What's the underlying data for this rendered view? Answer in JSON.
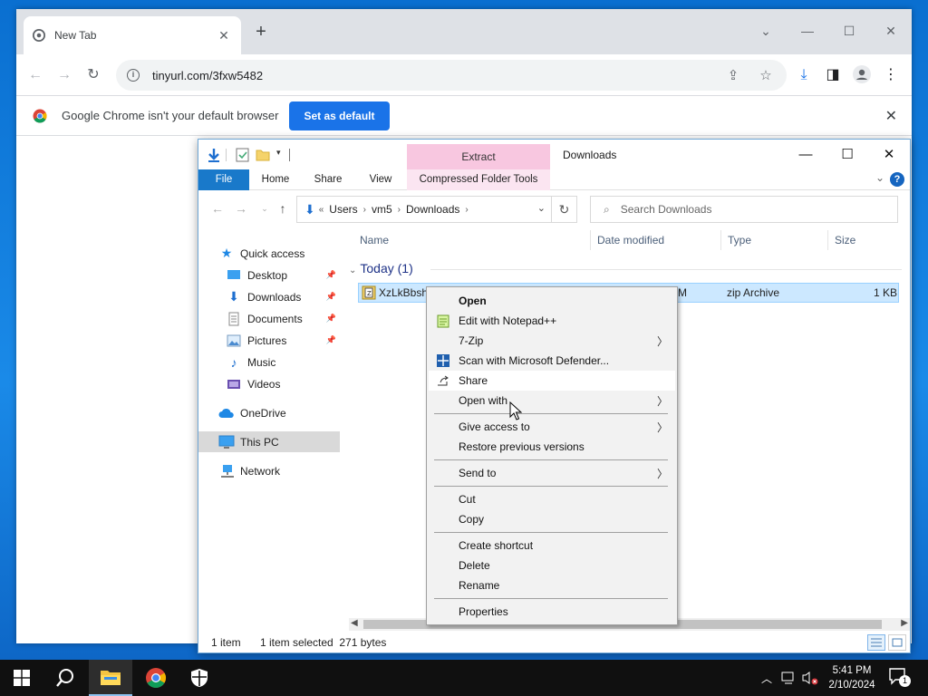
{
  "chrome": {
    "tab_title": "New Tab",
    "url": "tinyurl.com/3fxw5482",
    "infobar_message": "Google Chrome isn't your default browser",
    "infobar_button": "Set as default"
  },
  "explorer": {
    "contextual_tab": "Extract",
    "window_title": "Downloads",
    "ribbon_tabs": [
      "File",
      "Home",
      "Share",
      "View",
      "Compressed Folder Tools"
    ],
    "breadcrumb": [
      "Users",
      "vm5",
      "Downloads"
    ],
    "breadcrumb_prefix": "«",
    "search_placeholder": "Search Downloads",
    "nav_items": [
      {
        "label": "Quick access"
      },
      {
        "label": "Desktop"
      },
      {
        "label": "Downloads"
      },
      {
        "label": "Documents"
      },
      {
        "label": "Pictures"
      },
      {
        "label": "Music"
      },
      {
        "label": "Videos"
      },
      {
        "label": "OneDrive"
      },
      {
        "label": "This PC"
      },
      {
        "label": "Network"
      }
    ],
    "columns": [
      "Name",
      "Date modified",
      "Type",
      "Size"
    ],
    "group_label": "Today (1)",
    "file": {
      "name": "XzLkBbshc",
      "date_fragment": "M",
      "type": "zip Archive",
      "size": "1 KB"
    },
    "status": {
      "items": "1 item",
      "selected": "1 item selected  271 bytes"
    }
  },
  "context_menu": {
    "items": [
      {
        "label": "Open"
      },
      {
        "label": "Edit with Notepad++"
      },
      {
        "label": "7-Zip"
      },
      {
        "label": "Scan with Microsoft Defender..."
      },
      {
        "label": "Share"
      },
      {
        "label": "Open with"
      },
      {
        "label": "Give access to"
      },
      {
        "label": "Restore previous versions"
      },
      {
        "label": "Send to"
      },
      {
        "label": "Cut"
      },
      {
        "label": "Copy"
      },
      {
        "label": "Create shortcut"
      },
      {
        "label": "Delete"
      },
      {
        "label": "Rename"
      },
      {
        "label": "Properties"
      }
    ]
  },
  "taskbar": {
    "time": "5:41 PM",
    "date": "2/10/2024",
    "notification_count": "1"
  },
  "colors": {
    "accent_blue": "#1a73e8",
    "explorer_file_tab": "#1979ca",
    "extract_pink": "#f8c7e0",
    "selection": "#cce8ff",
    "taskbar": "#101010"
  }
}
